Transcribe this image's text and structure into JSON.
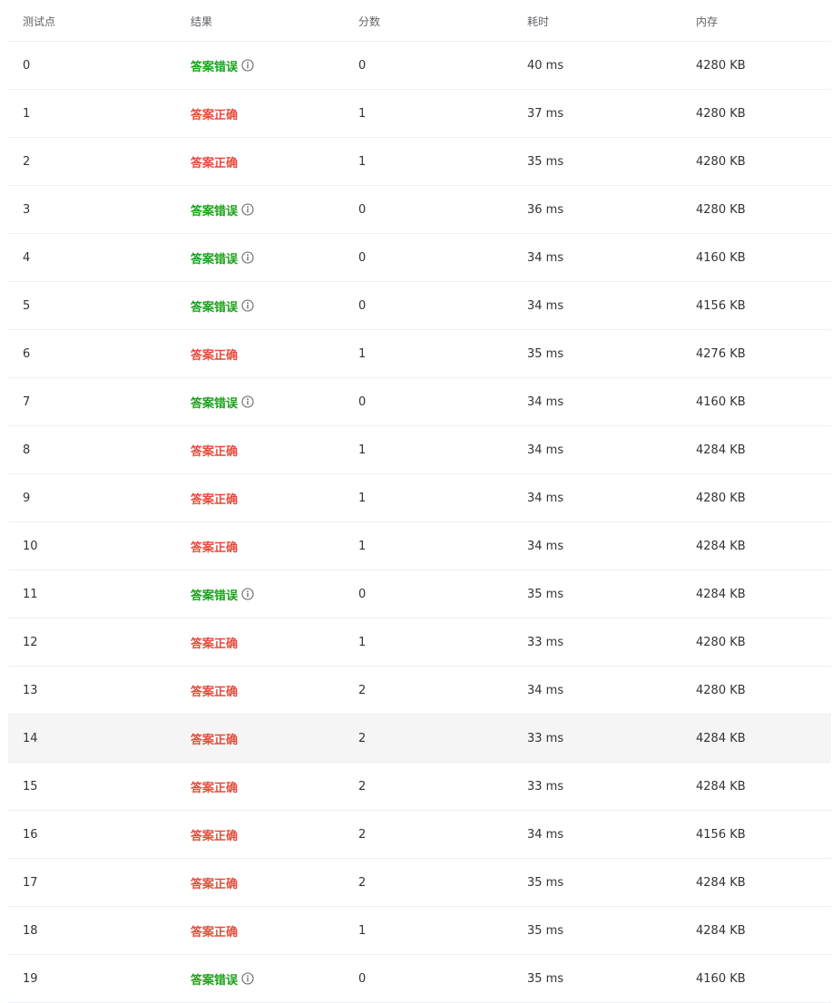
{
  "colors": {
    "wrong": "#1aa31a",
    "correct": "#e74c3c",
    "icon": "#666666"
  },
  "headers": [
    "测试点",
    "结果",
    "分数",
    "耗时",
    "内存"
  ],
  "rows": [
    {
      "id": "0",
      "result": "答案错误",
      "status": "wrong",
      "score": "0",
      "time": "40 ms",
      "memory": "4280 KB"
    },
    {
      "id": "1",
      "result": "答案正确",
      "status": "correct",
      "score": "1",
      "time": "37 ms",
      "memory": "4280 KB"
    },
    {
      "id": "2",
      "result": "答案正确",
      "status": "correct",
      "score": "1",
      "time": "35 ms",
      "memory": "4280 KB"
    },
    {
      "id": "3",
      "result": "答案错误",
      "status": "wrong",
      "score": "0",
      "time": "36 ms",
      "memory": "4280 KB"
    },
    {
      "id": "4",
      "result": "答案错误",
      "status": "wrong",
      "score": "0",
      "time": "34 ms",
      "memory": "4160 KB"
    },
    {
      "id": "5",
      "result": "答案错误",
      "status": "wrong",
      "score": "0",
      "time": "34 ms",
      "memory": "4156 KB"
    },
    {
      "id": "6",
      "result": "答案正确",
      "status": "correct",
      "score": "1",
      "time": "35 ms",
      "memory": "4276 KB"
    },
    {
      "id": "7",
      "result": "答案错误",
      "status": "wrong",
      "score": "0",
      "time": "34 ms",
      "memory": "4160 KB"
    },
    {
      "id": "8",
      "result": "答案正确",
      "status": "correct",
      "score": "1",
      "time": "34 ms",
      "memory": "4284 KB"
    },
    {
      "id": "9",
      "result": "答案正确",
      "status": "correct",
      "score": "1",
      "time": "34 ms",
      "memory": "4280 KB"
    },
    {
      "id": "10",
      "result": "答案正确",
      "status": "correct",
      "score": "1",
      "time": "34 ms",
      "memory": "4284 KB"
    },
    {
      "id": "11",
      "result": "答案错误",
      "status": "wrong",
      "score": "0",
      "time": "35 ms",
      "memory": "4284 KB"
    },
    {
      "id": "12",
      "result": "答案正确",
      "status": "correct",
      "score": "1",
      "time": "33 ms",
      "memory": "4280 KB"
    },
    {
      "id": "13",
      "result": "答案正确",
      "status": "correct",
      "score": "2",
      "time": "34 ms",
      "memory": "4280 KB"
    },
    {
      "id": "14",
      "result": "答案正确",
      "status": "correct",
      "score": "2",
      "time": "33 ms",
      "memory": "4284 KB",
      "hover": true
    },
    {
      "id": "15",
      "result": "答案正确",
      "status": "correct",
      "score": "2",
      "time": "33 ms",
      "memory": "4284 KB"
    },
    {
      "id": "16",
      "result": "答案正确",
      "status": "correct",
      "score": "2",
      "time": "34 ms",
      "memory": "4156 KB"
    },
    {
      "id": "17",
      "result": "答案正确",
      "status": "correct",
      "score": "2",
      "time": "35 ms",
      "memory": "4284 KB"
    },
    {
      "id": "18",
      "result": "答案正确",
      "status": "correct",
      "score": "1",
      "time": "35 ms",
      "memory": "4284 KB"
    },
    {
      "id": "19",
      "result": "答案错误",
      "status": "wrong",
      "score": "0",
      "time": "35 ms",
      "memory": "4160 KB"
    }
  ]
}
